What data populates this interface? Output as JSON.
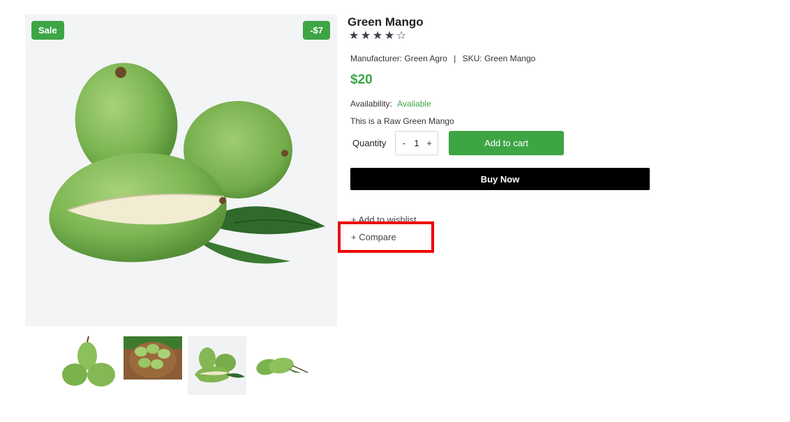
{
  "product": {
    "title": "Green Mango",
    "rating_stars": [
      "★",
      "★",
      "★",
      "★",
      "☆"
    ],
    "rating_value": 4,
    "manufacturer_label": "Manufacturer:",
    "manufacturer": "Green Agro",
    "sku_label": "SKU:",
    "sku": "Green Mango",
    "separator": "|",
    "price": "$20",
    "availability_label": "Availability:",
    "availability": "Available",
    "description": "This is a Raw Green Mango"
  },
  "badges": {
    "sale": "Sale",
    "discount": "-$7"
  },
  "quantity": {
    "label": "Quantity",
    "minus": "-",
    "value": "1",
    "plus": "+"
  },
  "actions": {
    "add_to_cart": "Add to cart",
    "buy_now": "Buy Now",
    "wishlist": "+ Add to wishlist",
    "compare": "+ Compare"
  },
  "colors": {
    "accent": "#3ea545",
    "buy_now_bg": "#000000",
    "highlight": "#ee0000"
  }
}
